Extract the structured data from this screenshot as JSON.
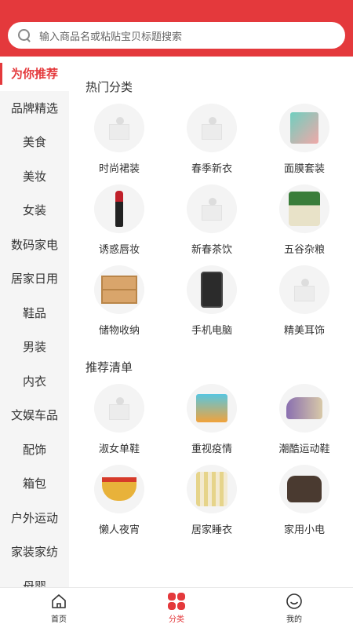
{
  "search": {
    "placeholder": "输入商品名或粘贴宝贝标题搜索"
  },
  "sidebar": {
    "items": [
      {
        "label": "为你推荐",
        "active": true
      },
      {
        "label": "品牌精选"
      },
      {
        "label": "美食"
      },
      {
        "label": "美妆"
      },
      {
        "label": "女装"
      },
      {
        "label": "数码家电"
      },
      {
        "label": "居家日用"
      },
      {
        "label": "鞋品"
      },
      {
        "label": "男装"
      },
      {
        "label": "内衣"
      },
      {
        "label": "文娱车品"
      },
      {
        "label": "配饰"
      },
      {
        "label": "箱包"
      },
      {
        "label": "户外运动"
      },
      {
        "label": "家装家纺"
      },
      {
        "label": "母婴"
      }
    ]
  },
  "hot": {
    "title": "热门分类",
    "items": [
      {
        "label": "时尚裙装",
        "icon": "placeholder-box"
      },
      {
        "label": "春季新衣",
        "icon": "placeholder-box"
      },
      {
        "label": "面膜套装",
        "icon": "face-mask-box"
      },
      {
        "label": "诱惑唇妆",
        "icon": "lipstick"
      },
      {
        "label": "新春茶饮",
        "icon": "placeholder-box"
      },
      {
        "label": "五谷杂粮",
        "icon": "rice-bag"
      },
      {
        "label": "储物收纳",
        "icon": "storage-drawer"
      },
      {
        "label": "手机电脑",
        "icon": "mobile-phone"
      },
      {
        "label": "精美耳饰",
        "icon": "placeholder-box"
      }
    ]
  },
  "recommend": {
    "title": "推荐清单",
    "items": [
      {
        "label": "淑女单鞋",
        "icon": "placeholder-box"
      },
      {
        "label": "重视疫情",
        "icon": "epidemic-kit"
      },
      {
        "label": "潮酷运动鞋",
        "icon": "sneaker"
      },
      {
        "label": "懒人夜宵",
        "icon": "instant-noodles"
      },
      {
        "label": "居家睡衣",
        "icon": "pajamas"
      },
      {
        "label": "家用小电",
        "icon": "rice-cooker"
      }
    ]
  },
  "tabbar": {
    "tabs": [
      {
        "label": "首页",
        "icon": "home-icon"
      },
      {
        "label": "分类",
        "icon": "category-icon",
        "active": true
      },
      {
        "label": "我的",
        "icon": "profile-icon"
      }
    ]
  },
  "colors": {
    "accent": "#e4393c",
    "sidebar_bg": "#f5f5f5"
  }
}
